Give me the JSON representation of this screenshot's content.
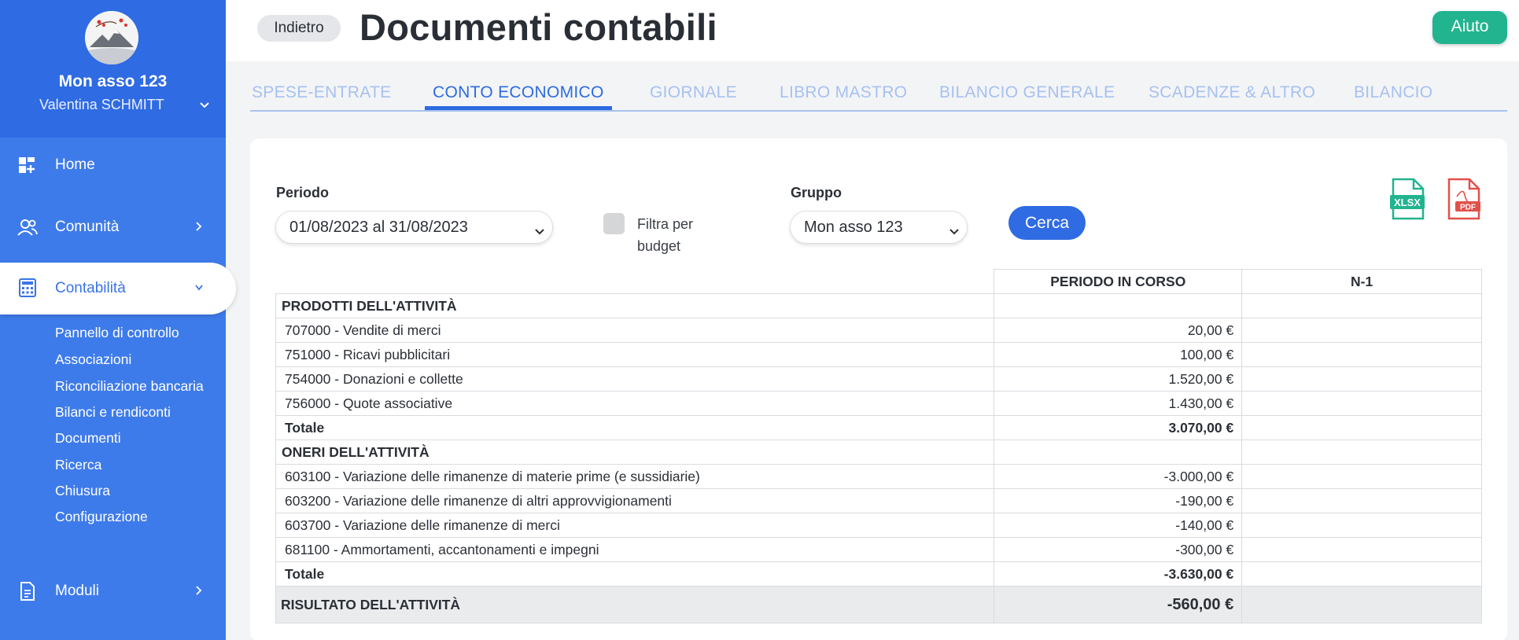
{
  "sidebar": {
    "org_name": "Mon asso 123",
    "user_name": "Valentina SCHMITT",
    "nav": {
      "home": "Home",
      "comunita": "Comunità",
      "contabilita": "Contabilità",
      "moduli": "Moduli"
    },
    "sub_items": [
      "Pannello di controllo",
      "Associazioni",
      "Riconciliazione bancaria",
      "Bilanci e rendiconti",
      "Documenti",
      "Ricerca",
      "Chiusura",
      "Configurazione"
    ]
  },
  "header": {
    "back_label": "Indietro",
    "title": "Documenti contabili",
    "help_label": "Aiuto"
  },
  "tabs": [
    "SPESE-ENTRATE",
    "CONTO ECONOMICO",
    "GIORNALE",
    "LIBRO MASTRO",
    "BILANCIO GENERALE",
    "SCADENZE & ALTRO",
    "BILANCIO"
  ],
  "active_tab": "CONTO ECONOMICO",
  "filters": {
    "period_label": "Periodo",
    "period_value": "01/08/2023 al 31/08/2023",
    "budget_filter_label": "Filtra per budget",
    "budget_filter_checked": false,
    "group_label": "Gruppo",
    "group_value": "Mon asso 123",
    "search_label": "Cerca",
    "xlsx_label": "XLSX",
    "pdf_label": "PDF"
  },
  "table": {
    "headers": [
      "PERIODO IN CORSO",
      "N-1"
    ],
    "income": {
      "title": "PRODOTTI DELL'ATTIVITÀ",
      "rows": [
        {
          "label": "707000 - Vendite di merci",
          "current": "20,00 €",
          "prev": ""
        },
        {
          "label": "751000 - Ricavi pubblicitari",
          "current": "100,00 €",
          "prev": ""
        },
        {
          "label": "754000 - Donazioni e collette",
          "current": "1.520,00 €",
          "prev": ""
        },
        {
          "label": "756000 - Quote associative",
          "current": "1.430,00 €",
          "prev": ""
        }
      ],
      "total_label": "Totale",
      "total_value": "3.070,00 €"
    },
    "expenses": {
      "title": "ONERI DELL'ATTIVITÀ",
      "rows": [
        {
          "label": "603100 - Variazione delle rimanenze di materie prime (e sussidiarie)",
          "current": "-3.000,00 €",
          "prev": ""
        },
        {
          "label": "603200 - Variazione delle rimanenze di altri approvvigionamenti",
          "current": "-190,00 €",
          "prev": ""
        },
        {
          "label": "603700 - Variazione delle rimanenze di merci",
          "current": "-140,00 €",
          "prev": ""
        },
        {
          "label": "681100 - Ammortamenti, accantonamenti e impegni",
          "current": "-300,00 €",
          "prev": ""
        }
      ],
      "total_label": "Totale",
      "total_value": "-3.630,00 €"
    },
    "result_label": "RISULTATO DELL'ATTIVITÀ",
    "result_value": "-560,00 €"
  },
  "colors": {
    "sidebar": "#3e7bea",
    "sidebar_header": "#2f6be2",
    "accent": "#2d6ce0",
    "help_button": "#21b48f",
    "xlsx_icon": "#21b48f",
    "pdf_icon": "#e2504a"
  },
  "icons": [
    "dashboard-icon",
    "users-icon",
    "calculator-icon",
    "document-icon",
    "chevron-down-icon",
    "chevron-right-icon",
    "xlsx-file-icon",
    "pdf-file-icon"
  ]
}
